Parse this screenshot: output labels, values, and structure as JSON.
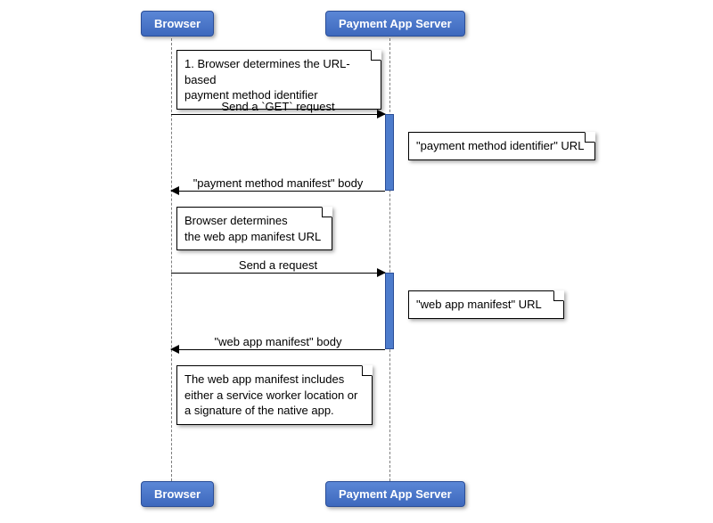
{
  "participants": {
    "browser": "Browser",
    "server": "Payment App Server"
  },
  "notes": {
    "n1": "1. Browser determines the URL-based\npayment method identifier",
    "n2": "\"payment method identifier\" URL",
    "n3": "Browser determines\nthe web app manifest URL",
    "n4": "\"web app manifest\" URL",
    "n5": "The web app manifest includes\neither a service worker location or\na signature of the native app."
  },
  "messages": {
    "m1": "Send a `GET` request",
    "m2": "\"payment method manifest\" body",
    "m3": "Send a request",
    "m4": "\"web app manifest\" body"
  },
  "chart_data": {
    "type": "sequence-diagram",
    "participants": [
      "Browser",
      "Payment App Server"
    ],
    "steps": [
      {
        "type": "note",
        "on": "Browser",
        "text": "1. Browser determines the URL-based payment method identifier"
      },
      {
        "type": "message",
        "from": "Browser",
        "to": "Payment App Server",
        "label": "Send a `GET` request"
      },
      {
        "type": "note",
        "on": "Payment App Server",
        "text": "\"payment method identifier\" URL"
      },
      {
        "type": "message",
        "from": "Payment App Server",
        "to": "Browser",
        "label": "\"payment method manifest\" body"
      },
      {
        "type": "note",
        "on": "Browser",
        "text": "Browser determines the web app manifest URL"
      },
      {
        "type": "message",
        "from": "Browser",
        "to": "Payment App Server",
        "label": "Send a request"
      },
      {
        "type": "note",
        "on": "Payment App Server",
        "text": "\"web app manifest\" URL"
      },
      {
        "type": "message",
        "from": "Payment App Server",
        "to": "Browser",
        "label": "\"web app manifest\" body"
      },
      {
        "type": "note",
        "on": "Browser",
        "text": "The web app manifest includes either a service worker location or a signature of the native app."
      }
    ]
  }
}
